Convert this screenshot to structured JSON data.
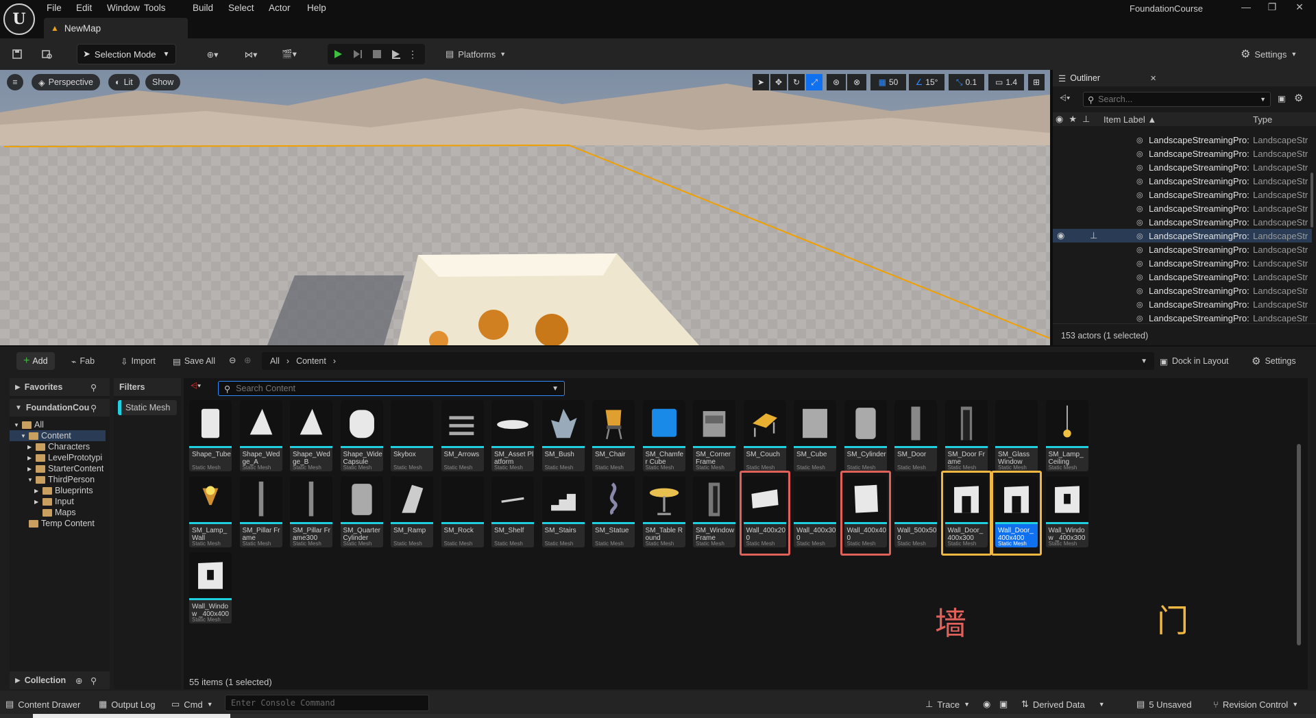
{
  "app": {
    "project_name": "FoundationCourse",
    "logo": "unreal-logo"
  },
  "menu": [
    "File",
    "Edit",
    "Window",
    "Tools",
    "Build",
    "Select",
    "Actor",
    "Help"
  ],
  "document_tab": {
    "label": "NewMap",
    "icon": "map-icon"
  },
  "toolbar": {
    "selection_mode": "Selection Mode",
    "platforms": "Platforms",
    "settings": "Settings"
  },
  "viewport": {
    "view_label": "Perspective",
    "lit_label": "Lit",
    "show_label": "Show",
    "grid_snap": "50",
    "angle_snap": "15°",
    "scale_snap": "0.1",
    "camera_speed": "1.4"
  },
  "outliner": {
    "title": "Outliner",
    "search_placeholder": "Search...",
    "col_label": "Item Label ▲",
    "col_type": "Type",
    "rows": [
      {
        "label": "LandscapeStreamingPro:",
        "type": "LandscapeStr",
        "selected": false
      },
      {
        "label": "LandscapeStreamingPro:",
        "type": "LandscapeStr",
        "selected": false
      },
      {
        "label": "LandscapeStreamingPro:",
        "type": "LandscapeStr",
        "selected": false
      },
      {
        "label": "LandscapeStreamingPro:",
        "type": "LandscapeStr",
        "selected": false
      },
      {
        "label": "LandscapeStreamingPro:",
        "type": "LandscapeStr",
        "selected": false
      },
      {
        "label": "LandscapeStreamingPro:",
        "type": "LandscapeStr",
        "selected": false
      },
      {
        "label": "LandscapeStreamingPro:",
        "type": "LandscapeStr",
        "selected": false
      },
      {
        "label": "LandscapeStreamingPro:",
        "type": "LandscapeStr",
        "selected": true
      },
      {
        "label": "LandscapeStreamingPro:",
        "type": "LandscapeStr",
        "selected": false
      },
      {
        "label": "LandscapeStreamingPro:",
        "type": "LandscapeStr",
        "selected": false
      },
      {
        "label": "LandscapeStreamingPro:",
        "type": "LandscapeStr",
        "selected": false
      },
      {
        "label": "LandscapeStreamingPro:",
        "type": "LandscapeStr",
        "selected": false
      },
      {
        "label": "LandscapeStreamingPro:",
        "type": "LandscapeStr",
        "selected": false
      },
      {
        "label": "LandscapeStreamingPro:",
        "type": "LandscapeStr",
        "selected": false
      }
    ],
    "footer": "153 actors (1 selected)"
  },
  "content_browser": {
    "add": "Add",
    "fab": "Fab",
    "import": "Import",
    "save_all": "Save All",
    "breadcrumb": [
      "All",
      "Content"
    ],
    "dock_in_layout": "Dock in Layout",
    "settings": "Settings",
    "favorites": "Favorites",
    "project_root": "FoundationCou",
    "filters": "Filters",
    "filter_chip": "Static Mesh",
    "search_placeholder": "Search Content",
    "collection": "Collection",
    "item_count": "55 items (1 selected)",
    "tree": [
      {
        "label": "All",
        "depth": 0,
        "expanded": true
      },
      {
        "label": "Content",
        "depth": 1,
        "expanded": true,
        "selected": true
      },
      {
        "label": "Characters",
        "depth": 2
      },
      {
        "label": "LevelPrototypi",
        "depth": 2
      },
      {
        "label": "StarterContent",
        "depth": 2
      },
      {
        "label": "ThirdPerson",
        "depth": 2,
        "expanded": true
      },
      {
        "label": "Blueprints",
        "depth": 3
      },
      {
        "label": "Input",
        "depth": 3
      },
      {
        "label": "Maps",
        "depth": 3
      },
      {
        "label": "Temp Content",
        "depth": 1
      }
    ],
    "asset_type_label": "Static Mesh",
    "assets": [
      {
        "name": "Shape_Tube",
        "thumb": "tube"
      },
      {
        "name": "Shape_Wedge_A",
        "thumb": "wedge"
      },
      {
        "name": "Shape_Wedge_B",
        "thumb": "wedge"
      },
      {
        "name": "Shape_Wide Capsule",
        "thumb": "capsule"
      },
      {
        "name": "Skybox",
        "thumb": "none"
      },
      {
        "name": "SM_Arrows",
        "thumb": "arrows"
      },
      {
        "name": "SM_Asset Platform",
        "thumb": "disc"
      },
      {
        "name": "SM_Bush",
        "thumb": "bush"
      },
      {
        "name": "SM_Chair",
        "thumb": "chair"
      },
      {
        "name": "SM_Chamfer Cube",
        "thumb": "bluecube"
      },
      {
        "name": "SM_Corner Frame",
        "thumb": "box"
      },
      {
        "name": "SM_Couch",
        "thumb": "couch"
      },
      {
        "name": "SM_Cube",
        "thumb": "cube"
      },
      {
        "name": "SM_Cylinder",
        "thumb": "cylinder"
      },
      {
        "name": "SM_Door",
        "thumb": "door"
      },
      {
        "name": "SM_Door Frame",
        "thumb": "doorframe"
      },
      {
        "name": "SM_Glass Window",
        "thumb": "none"
      },
      {
        "name": "SM_Lamp_ Ceiling",
        "thumb": "lampc"
      },
      {
        "name": "SM_Lamp_ Wall",
        "thumb": "lampw"
      },
      {
        "name": "SM_Pillar Frame",
        "thumb": "pillar"
      },
      {
        "name": "SM_Pillar Frame300",
        "thumb": "pillar"
      },
      {
        "name": "SM_Quarter Cylinder",
        "thumb": "cylinder"
      },
      {
        "name": "SM_Ramp",
        "thumb": "ramp"
      },
      {
        "name": "SM_Rock",
        "thumb": "none"
      },
      {
        "name": "SM_Shelf",
        "thumb": "shelf"
      },
      {
        "name": "SM_Stairs",
        "thumb": "stairs"
      },
      {
        "name": "SM_Statue",
        "thumb": "statue"
      },
      {
        "name": "SM_Table Round",
        "thumb": "table"
      },
      {
        "name": "SM_Window Frame",
        "thumb": "winframe"
      },
      {
        "name": "Wall_400x200",
        "thumb": "wallwide"
      },
      {
        "name": "Wall_400x300",
        "thumb": "none"
      },
      {
        "name": "Wall_400x400",
        "thumb": "wall"
      },
      {
        "name": "Wall_500x500",
        "thumb": "none"
      },
      {
        "name": "Wall_Door_ 400x300",
        "thumb": "walldoor"
      },
      {
        "name": "Wall_Door_ 400x400",
        "thumb": "walldoor",
        "selected": true
      },
      {
        "name": "Wall_Window _400x300",
        "thumb": "wallwin"
      },
      {
        "name": "Wall_Window _400x400",
        "thumb": "wallwin"
      }
    ],
    "annotations": [
      {
        "text": "墙",
        "color": "#e0605a"
      },
      {
        "text": "门",
        "color": "#f0b840"
      }
    ]
  },
  "statusbar": {
    "content_drawer": "Content Drawer",
    "output_log": "Output Log",
    "cmd": "Cmd",
    "console_placeholder": "Enter Console Command",
    "trace": "Trace",
    "derived_data": "Derived Data",
    "unsaved": "5 Unsaved",
    "revision_control": "Revision Control"
  },
  "colors": {
    "accent_selection": "#0f70f0",
    "static_mesh_bar": "#1fd0e0",
    "annotation_wall": "#e0605a",
    "annotation_door": "#f0b840",
    "play_green": "#3fbf3f"
  }
}
